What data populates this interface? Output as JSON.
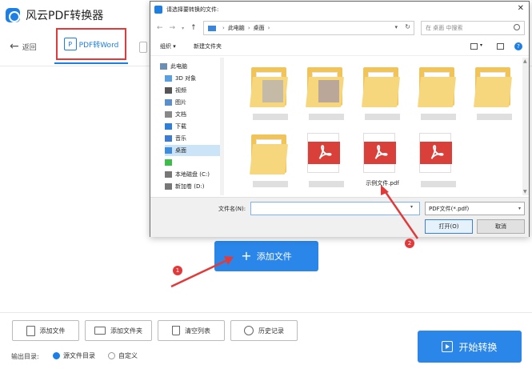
{
  "app": {
    "title": "风云PDF转换器",
    "back_label": "返回",
    "active_tab_label": "PDF转Word",
    "active_tab_icon": "pdf-document-icon",
    "add_file_label": "添加文件",
    "start_convert_label": "开始转换",
    "accent_color": "#2a86e8"
  },
  "toolbar": {
    "buttons": [
      {
        "label": "添加文件",
        "icon": "file-icon"
      },
      {
        "label": "添加文件夹",
        "icon": "folder-icon"
      },
      {
        "label": "清空列表",
        "icon": "trash-icon"
      },
      {
        "label": "历史记录",
        "icon": "clock-icon"
      }
    ]
  },
  "output": {
    "label": "输出目录:",
    "options": [
      {
        "label": "源文件目录",
        "selected": true
      },
      {
        "label": "自定义",
        "selected": false
      }
    ]
  },
  "dialog": {
    "title": "请选择要转换的文件:",
    "breadcrumb": [
      "此电脑",
      "桌面"
    ],
    "search_placeholder": "在 桌面 中搜索",
    "organize_label": "组织 ▾",
    "new_folder_label": "新建文件夹",
    "tree": [
      {
        "label": "此电脑",
        "icon": "computer-icon"
      },
      {
        "label": "3D 对象",
        "icon": "cube-icon"
      },
      {
        "label": "视频",
        "icon": "video-icon"
      },
      {
        "label": "图片",
        "icon": "picture-icon"
      },
      {
        "label": "文档",
        "icon": "document-icon"
      },
      {
        "label": "下载",
        "icon": "download-icon"
      },
      {
        "label": "音乐",
        "icon": "music-icon"
      },
      {
        "label": "桌面",
        "icon": "desktop-icon",
        "selected": true
      },
      {
        "label": "",
        "icon": "green-app-icon"
      },
      {
        "label": "本地磁盘 (C:)",
        "icon": "disk-icon"
      },
      {
        "label": "新加卷 (D:)",
        "icon": "disk-icon"
      }
    ],
    "files": [
      {
        "type": "folder",
        "name": ""
      },
      {
        "type": "folder",
        "name": ""
      },
      {
        "type": "folder",
        "name": ""
      },
      {
        "type": "folder",
        "name": ""
      },
      {
        "type": "folder",
        "name": ""
      },
      {
        "type": "folder",
        "name": ""
      },
      {
        "type": "pdf",
        "name": ""
      },
      {
        "type": "pdf",
        "name": "示例文件.pdf"
      },
      {
        "type": "pdf",
        "name": ""
      }
    ],
    "filename_label": "文件名(N):",
    "filename_value": "",
    "filetype_value": "PDF文件(*.pdf)",
    "open_label": "打开(O)",
    "cancel_label": "取消"
  },
  "annotations": {
    "badge_1": "1",
    "badge_2": "2",
    "color": "#e23a3a"
  }
}
